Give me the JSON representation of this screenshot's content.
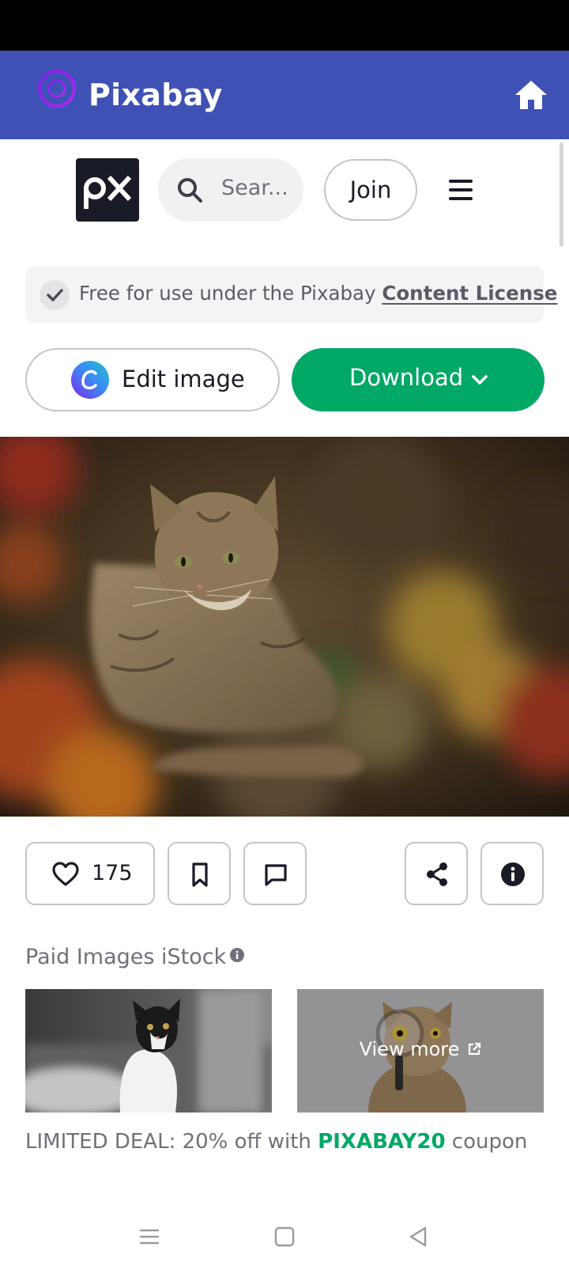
{
  "app_bar": {
    "title": "Pixabay",
    "color": "#3f51b5"
  },
  "site_header": {
    "logo_text": "px",
    "search_placeholder": "Sear...",
    "join_label": "Join"
  },
  "license": {
    "text": "Free for use under the Pixabay ",
    "link_label": "Content License"
  },
  "actions": {
    "edit_label": "Edit image",
    "download_label": "Download",
    "download_color": "#02a866"
  },
  "image_actions": {
    "like_count": "175"
  },
  "paid_images": {
    "title": "Paid Images iStock",
    "view_more_label": "View more"
  },
  "deal": {
    "prefix": "LIMITED DEAL: 20% off with ",
    "code": "PIXABAY20",
    "suffix": " coupon"
  },
  "icons": [
    "pixabay-logo-icon",
    "home-icon",
    "search-icon",
    "menu-icon",
    "check-icon",
    "canva-icon",
    "chevron-down-icon",
    "heart-icon",
    "bookmark-icon",
    "comment-icon",
    "share-icon",
    "info-icon",
    "external-link-icon",
    "recent-apps-icon",
    "home-nav-icon",
    "back-icon"
  ]
}
